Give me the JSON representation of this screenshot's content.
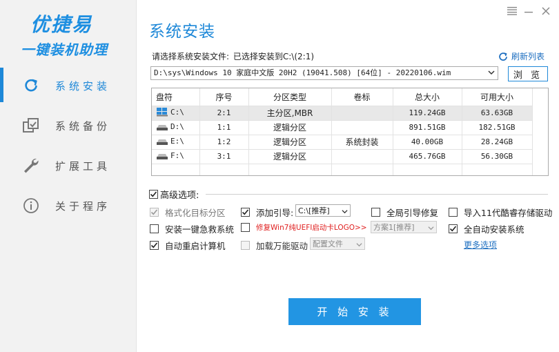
{
  "app": {
    "logo_line1": "优捷易",
    "logo_line2": "一键装机助理"
  },
  "sidebar": {
    "items": [
      {
        "label": "系统安装",
        "icon": "refresh-icon",
        "active": true
      },
      {
        "label": "系统备份",
        "icon": "backup-icon",
        "active": false
      },
      {
        "label": "扩展工具",
        "icon": "wrench-icon",
        "active": false
      },
      {
        "label": "关于程序",
        "icon": "info-icon",
        "active": false
      }
    ]
  },
  "page": {
    "title": "系统安装",
    "file_label": "请选择系统安装文件:",
    "file_target": "已选择安装到C:\\(2:1)",
    "refresh_label": "刷新列表",
    "image_path": "D:\\sys\\Windows 10 家庭中文版 20H2 (19041.508) [64位] - 20220106.wim",
    "browse_label": "浏 览"
  },
  "table": {
    "headers": [
      "盘符",
      "序号",
      "分区类型",
      "卷标",
      "总大小",
      "可用大小"
    ],
    "rows": [
      {
        "drive": "C:\\",
        "index": "2:1",
        "type": "主分区,MBR",
        "label": "",
        "total": "119.24GB",
        "free": "63.63GB",
        "selected": true,
        "system": true
      },
      {
        "drive": "D:\\",
        "index": "1:1",
        "type": "逻辑分区",
        "label": "",
        "total": "891.51GB",
        "free": "182.51GB",
        "selected": false,
        "system": false
      },
      {
        "drive": "E:\\",
        "index": "1:2",
        "type": "逻辑分区",
        "label": "系统封装",
        "total": "40.00GB",
        "free": "28.24GB",
        "selected": false,
        "system": false
      },
      {
        "drive": "F:\\",
        "index": "3:1",
        "type": "逻辑分区",
        "label": "",
        "total": "465.76GB",
        "free": "56.30GB",
        "selected": false,
        "system": false
      }
    ]
  },
  "advanced": {
    "title": "高级选项:",
    "format_target": "格式化目标分区",
    "add_boot": "添加引导:",
    "boot_drive": "C:\\[推荐]",
    "global_boot_fix": "全局引导修复",
    "import_11th_rst": "导入11代酷睿存储驱动",
    "install_rescue": "安装一键急救系统",
    "fix_win7_uefi": "修复Win7纯UEFI启动卡LOGO>>",
    "scheme": "方案1[推荐]",
    "auto_install": "全自动安装系统",
    "auto_reboot": "自动重启计算机",
    "load_driver": "加载万能驱动",
    "config_file": "配置文件",
    "more_options": "更多选项"
  },
  "actions": {
    "start_install": "开 始 安 装"
  },
  "colors": {
    "accent": "#1e88d8",
    "start_button": "#2295e3",
    "warning_text": "#e02020"
  }
}
